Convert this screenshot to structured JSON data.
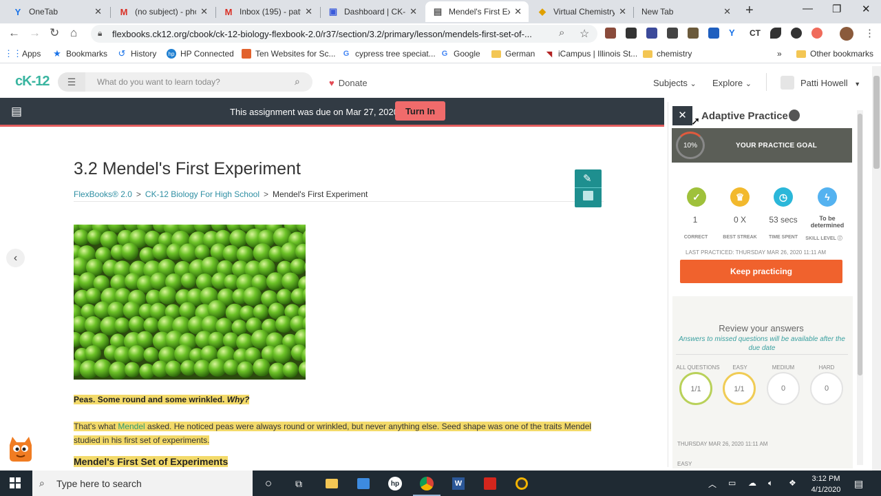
{
  "browser": {
    "tabs": [
      {
        "title": "OneTab",
        "icon": "onetab-icon",
        "active": false
      },
      {
        "title": "(no subject) - pho",
        "icon": "gmail-icon",
        "active": false
      },
      {
        "title": "Inbox (195) - patt",
        "icon": "gmail-icon",
        "active": false
      },
      {
        "title": "Dashboard | CK-12",
        "icon": "doc-icon",
        "active": false
      },
      {
        "title": "Mendel's First Exp",
        "icon": "book-icon",
        "active": true
      },
      {
        "title": "Virtual Chemistry",
        "icon": "chem-icon",
        "active": false
      },
      {
        "title": "New Tab",
        "icon": "",
        "active": false
      }
    ],
    "url": "flexbooks.ck12.org/cbook/ck-12-biology-flexbook-2.0/r37/section/3.2/primary/lesson/mendels-first-set-of-...",
    "extensions": {
      "ct_label": "CT"
    },
    "bookmarks": [
      {
        "label": "Apps",
        "icon": "apps-grid-icon"
      },
      {
        "label": "Bookmarks",
        "icon": "star-icon"
      },
      {
        "label": "History",
        "icon": "history-icon"
      },
      {
        "label": "HP Connected",
        "icon": "hp-icon"
      },
      {
        "label": "Ten Websites for Sc...",
        "icon": "site-icon"
      },
      {
        "label": "cypress tree speciat...",
        "icon": "google-icon"
      },
      {
        "label": "Google",
        "icon": "google-icon"
      },
      {
        "label": "German",
        "icon": "folder-icon"
      },
      {
        "label": "iCampus | Illinois St...",
        "icon": "bird-icon"
      },
      {
        "label": "chemistry",
        "icon": "folder-icon"
      }
    ],
    "bookmarks_more": "»",
    "other_bookmarks": "Other bookmarks"
  },
  "header": {
    "logo": "cK-12",
    "search_placeholder": "What do you want to learn today?",
    "donate": "Donate",
    "subjects": "Subjects",
    "explore": "Explore",
    "user": "Patti Howell",
    "chev": "⌄"
  },
  "banner": {
    "text": "This assignment was due on Mar 27, 2020.",
    "turn_in": "Turn In"
  },
  "lesson": {
    "title": "3.2 Mendel's First Experiment",
    "breadcrumb": {
      "part1": "FlexBooks® 2.0",
      "part2": "CK-12 Biology For High School",
      "part3": "Mendel's First Experiment",
      "sep": ">"
    },
    "caption_bold": "Peas. Some round and some wrinkled.",
    "caption_italic": "Why?",
    "para_pre": "That's what",
    "para_link": "Mendel",
    "para_post": "asked. He noticed peas were always round or wrinkled, but never anything else. Seed shape was one of the traits Mendel studied in his first set of experiments.",
    "subheading": "Mendel's First Set of Experiments"
  },
  "practice": {
    "title": "Adaptive Practice",
    "goal_percent": "10%",
    "goal_fraction": 0.1,
    "goal_label": "YOUR PRACTICE GOAL",
    "stats": [
      {
        "value": "1",
        "label": "CORRECT",
        "color": "#9fc13b",
        "icon": "check-icon"
      },
      {
        "value": "0 X",
        "label": "BEST STREAK",
        "color": "#f2b92d",
        "icon": "trophy-icon"
      },
      {
        "value": "53 secs",
        "label": "TIME SPENT",
        "color": "#2bb7d9",
        "icon": "timer-icon"
      },
      {
        "value": "To be determined",
        "label": "SKILL LEVEL",
        "color": "#54b2f0",
        "icon": "bolt-icon"
      }
    ],
    "last_practiced": "LAST PRACTICED: THURSDAY MAR 26, 2020 11:11 AM",
    "keep_practicing": "Keep practicing",
    "review_title": "Review your answers",
    "review_note": "Answers to missed questions will be available after the due date",
    "difficulty": [
      {
        "label": "ALL QUESTIONS",
        "value": "1/1"
      },
      {
        "label": "EASY",
        "value": "1/1"
      },
      {
        "label": "MEDIUM",
        "value": "0"
      },
      {
        "label": "HARD",
        "value": "0"
      }
    ],
    "review_date": "THURSDAY MAR 26, 2020 11:11 AM",
    "review_easy": "EASY"
  },
  "taskbar": {
    "search_placeholder": "Type here to search",
    "time": "3:12 PM",
    "date": "4/1/2020"
  },
  "colors": {
    "accent": "#39b5a0",
    "banner": "#323b44",
    "turn_in": "#f06b6b",
    "keep": "#f0622d"
  }
}
